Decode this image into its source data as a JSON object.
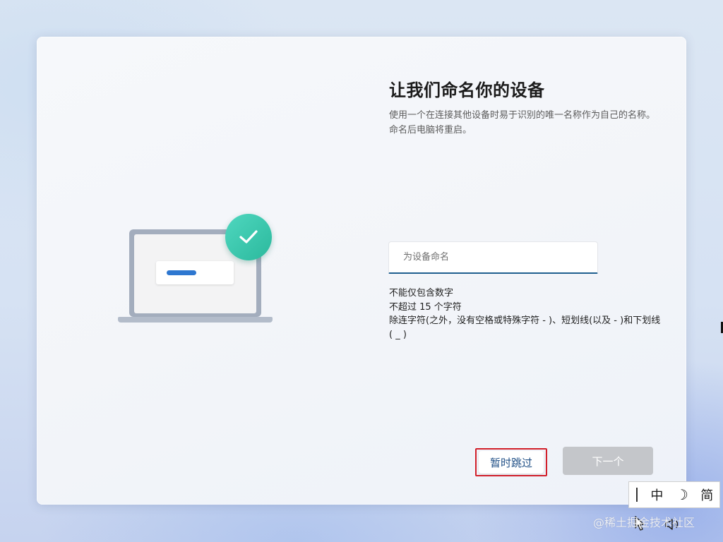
{
  "setup": {
    "title": "让我们命名你的设备",
    "subtitle": "使用一个在连接其他设备时易于识别的唯一名称作为自己的名称。命名后电脑将重启。",
    "name_input": {
      "placeholder": "为设备命名",
      "value": ""
    },
    "rules": [
      "不能仅包含数字",
      "不超过 15 个字符",
      "除连字符(之外，没有空格或特殊字符 - )、短划线(以及 - )和下划线( _ )"
    ],
    "skip_label": "暂时跳过",
    "next_label": "下一个",
    "next_enabled": false
  },
  "illustration": {
    "icons": [
      "laptop-icon",
      "checkmark-icon"
    ],
    "accent_color": "#2e77d0",
    "check_color": "#3cc8ad"
  },
  "ime_toolbar": {
    "mode_label": "中",
    "moon_glyph": "☽",
    "script_label": "简"
  },
  "tray": {
    "icons": [
      "cursor-icon",
      "volume-icon"
    ]
  },
  "watermark": "@稀土掘金技术社区",
  "colors": {
    "highlight_border": "#d21f2a",
    "input_underline": "#1f5f8f",
    "disabled_button": "#c4c6ca"
  }
}
